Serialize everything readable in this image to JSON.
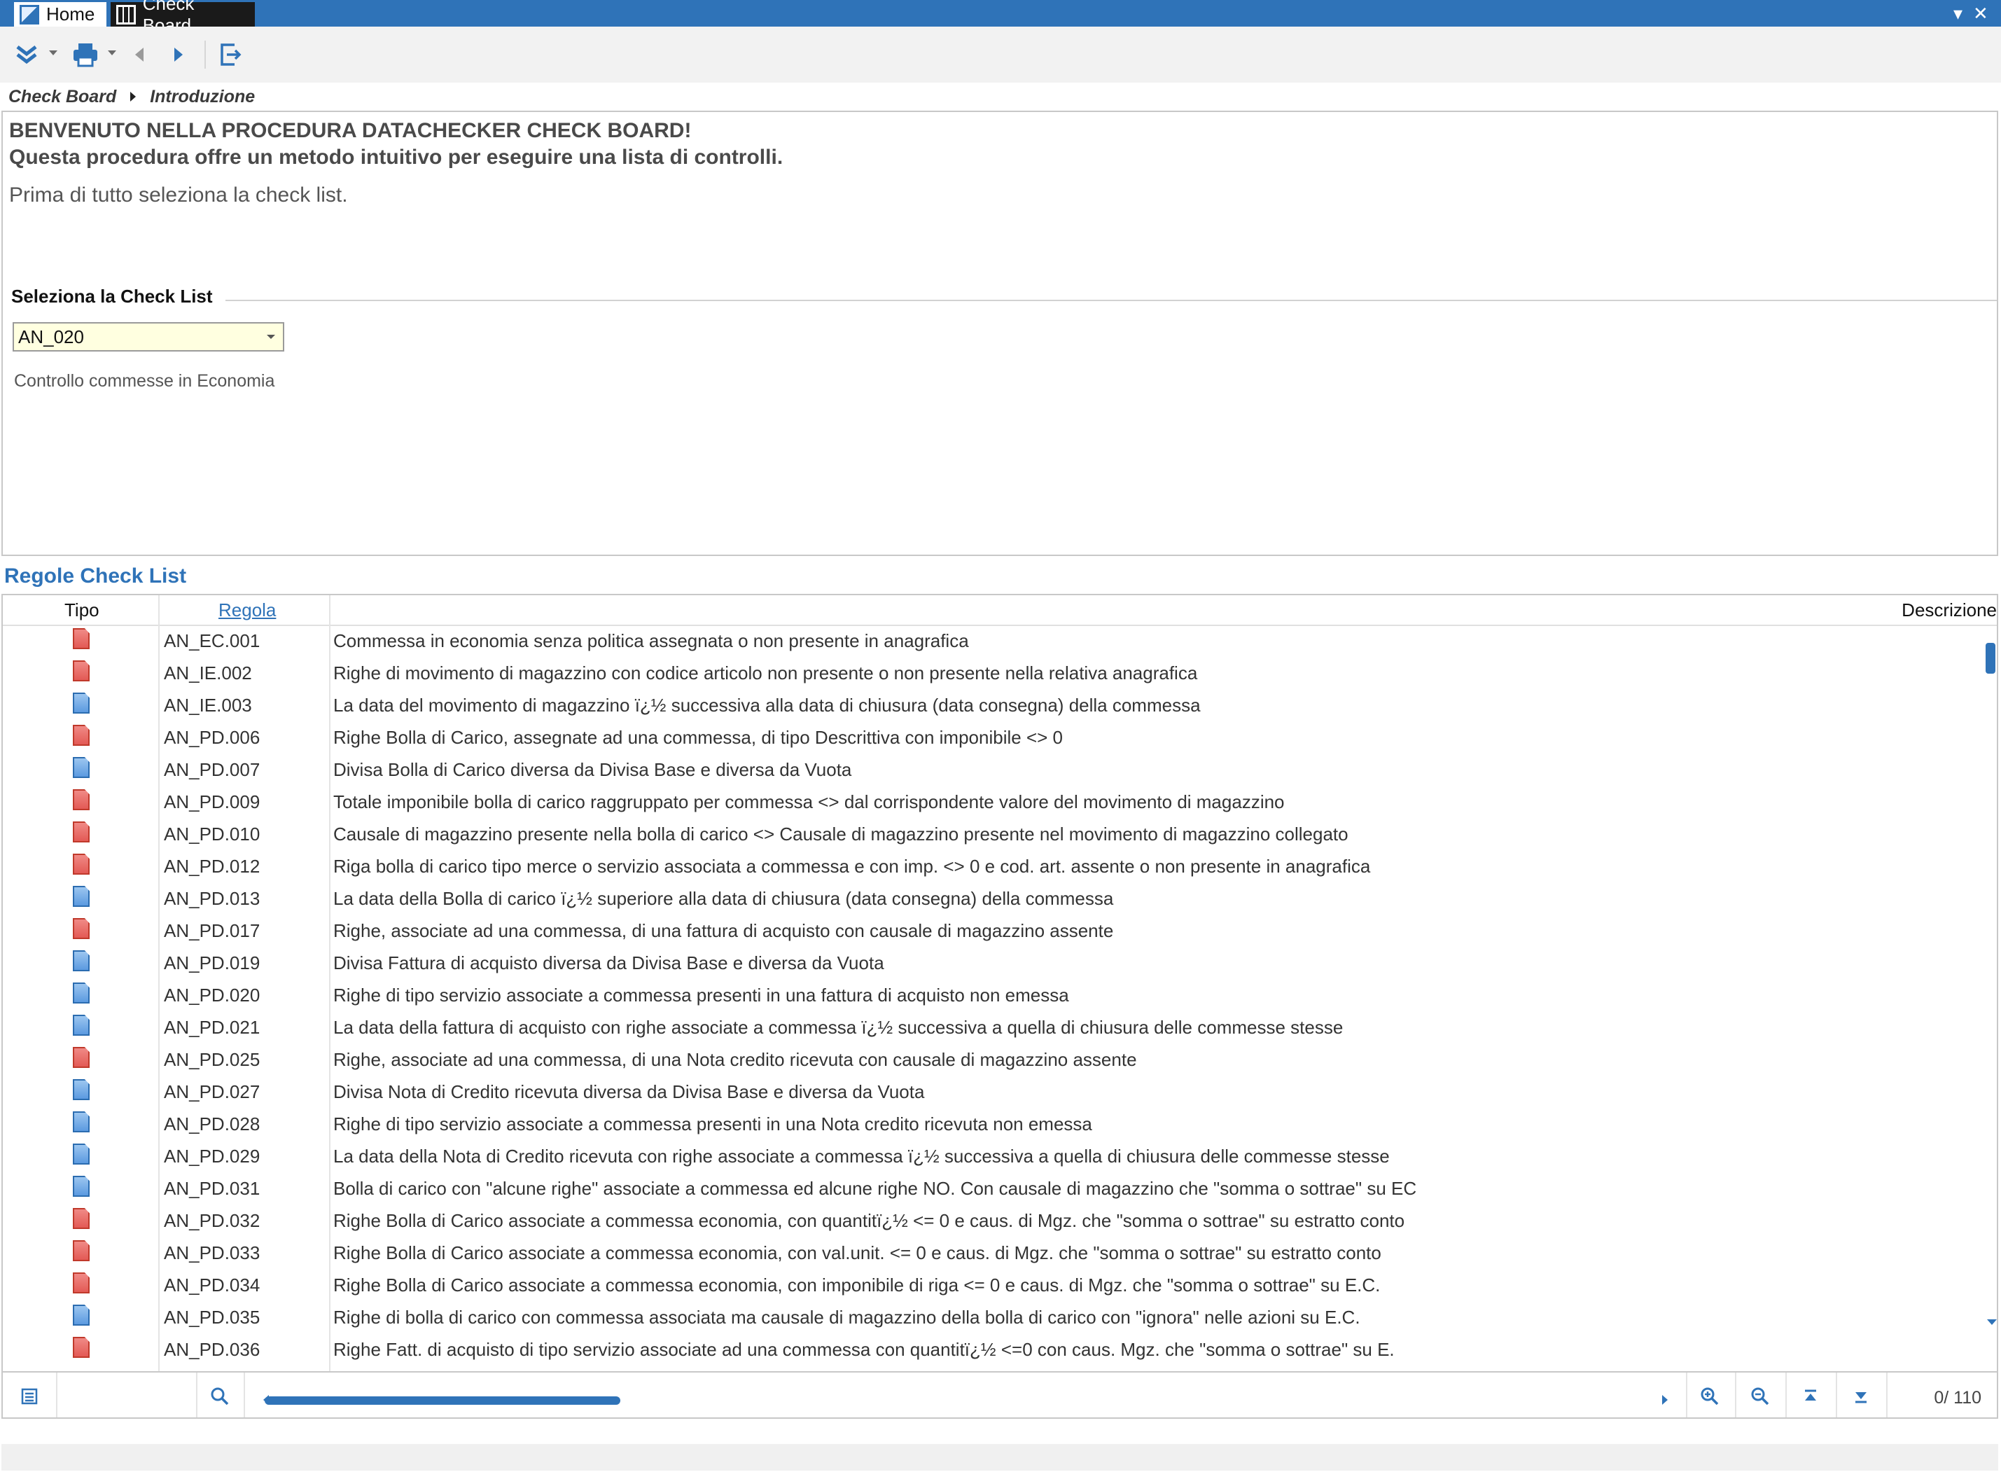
{
  "tabs": [
    {
      "label": "Home"
    },
    {
      "label": "Check Board"
    }
  ],
  "window_controls": {
    "dropdown_glyph": "▾",
    "close_glyph": "✕"
  },
  "toolbar": {
    "icons": [
      "expand-chevrons-icon",
      "print-icon",
      "back-arrow-icon",
      "forward-arrow-icon",
      "exit-icon"
    ]
  },
  "breadcrumb": {
    "root": "Check Board",
    "current": "Introduzione"
  },
  "intro": {
    "line1": "BENVENUTO NELLA PROCEDURA DATACHECKER CHECK BOARD!",
    "line2": "Questa procedura offre un metodo intuitivo per eseguire una lista di controlli.",
    "line3": "Prima di tutto seleziona la check list."
  },
  "checklist_group": {
    "legend": "Seleziona la Check List",
    "selected_value": "AN_020",
    "description": "Controllo commesse in Economia"
  },
  "rules": {
    "title": "Regole Check List",
    "columns": {
      "tipo": "Tipo",
      "regola": "Regola",
      "descrizione": "Descrizione"
    },
    "rows": [
      {
        "type": "red",
        "code": "AN_EC.001",
        "desc": "Commessa in economia senza politica assegnata o non presente in anagrafica"
      },
      {
        "type": "red",
        "code": "AN_IE.002",
        "desc": "Righe di movimento di magazzino con codice articolo non presente o non presente nella relativa anagrafica"
      },
      {
        "type": "blue",
        "code": "AN_IE.003",
        "desc": "La data del movimento di magazzino ï¿½ successiva alla data di chiusura (data consegna) della commessa"
      },
      {
        "type": "red",
        "code": "AN_PD.006",
        "desc": "Righe Bolla di Carico, assegnate ad una commessa, di tipo Descrittiva con imponibile <> 0"
      },
      {
        "type": "blue",
        "code": "AN_PD.007",
        "desc": "Divisa Bolla di Carico diversa da Divisa Base e diversa da Vuota"
      },
      {
        "type": "red",
        "code": "AN_PD.009",
        "desc": "Totale imponibile bolla di carico raggruppato per commessa <> dal corrispondente valore del movimento di magazzino"
      },
      {
        "type": "red",
        "code": "AN_PD.010",
        "desc": "Causale di magazzino presente nella bolla di carico <> Causale di magazzino presente nel movimento di magazzino collegato"
      },
      {
        "type": "red",
        "code": "AN_PD.012",
        "desc": "Riga bolla di carico tipo merce o servizio associata a commessa e con imp. <> 0 e cod. art. assente o non presente in anagrafica"
      },
      {
        "type": "blue",
        "code": "AN_PD.013",
        "desc": "La data della Bolla di carico ï¿½ superiore alla data di chiusura (data consegna) della commessa"
      },
      {
        "type": "red",
        "code": "AN_PD.017",
        "desc": "Righe, associate ad una commessa, di una fattura di acquisto con causale di magazzino assente"
      },
      {
        "type": "blue",
        "code": "AN_PD.019",
        "desc": "Divisa Fattura di acquisto diversa da Divisa Base e diversa da Vuota"
      },
      {
        "type": "blue",
        "code": "AN_PD.020",
        "desc": "Righe di tipo servizio associate a commessa presenti in una fattura di acquisto non emessa"
      },
      {
        "type": "blue",
        "code": "AN_PD.021",
        "desc": "La data della fattura di acquisto con righe associate a commessa ï¿½ successiva a quella di chiusura delle commesse stesse"
      },
      {
        "type": "red",
        "code": "AN_PD.025",
        "desc": "Righe, associate ad una commessa, di una Nota credito ricevuta con causale di magazzino assente"
      },
      {
        "type": "blue",
        "code": "AN_PD.027",
        "desc": "Divisa Nota di Credito ricevuta diversa da Divisa Base e diversa da Vuota"
      },
      {
        "type": "blue",
        "code": "AN_PD.028",
        "desc": "Righe di tipo servizio associate a commessa presenti in una Nota credito ricevuta non emessa"
      },
      {
        "type": "blue",
        "code": "AN_PD.029",
        "desc": "La data della Nota di Credito ricevuta con righe associate a commessa ï¿½ successiva a quella di chiusura delle commesse stesse"
      },
      {
        "type": "blue",
        "code": "AN_PD.031",
        "desc": "Bolla di carico con \"alcune righe\" associate a commessa ed alcune righe NO. Con causale di magazzino che \"somma o sottrae\" su EC"
      },
      {
        "type": "red",
        "code": "AN_PD.032",
        "desc": "Righe Bolla di Carico associate a commessa economia, con quantitï¿½ <= 0 e caus. di Mgz. che \"somma o sottrae\" su estratto conto"
      },
      {
        "type": "red",
        "code": "AN_PD.033",
        "desc": "Righe Bolla di Carico associate a commessa economia, con val.unit. <= 0 e caus. di Mgz. che \"somma o sottrae\" su estratto conto"
      },
      {
        "type": "red",
        "code": "AN_PD.034",
        "desc": "Righe Bolla di Carico associate a commessa economia, con imponibile di riga <= 0 e caus. di Mgz. che \"somma o sottrae\" su E.C."
      },
      {
        "type": "blue",
        "code": "AN_PD.035",
        "desc": "Righe di bolla di carico con commessa associata ma causale di magazzino della bolla di carico con \"ignora\" nelle azioni su E.C."
      },
      {
        "type": "red",
        "code": "AN_PD.036",
        "desc": "Righe Fatt. di acquisto di tipo servizio associate ad una commessa con quantitï¿½ <=0 con caus. Mgz. che \"somma o sottrae\" su E."
      }
    ]
  },
  "footer": {
    "pager_current": "0/",
    "pager_total": "110",
    "icons": [
      "list-icon",
      "search-icon",
      "zoom-in-icon",
      "zoom-out-icon",
      "first-record-icon",
      "last-record-icon"
    ]
  },
  "colors": {
    "accent": "#2f73b8",
    "doc_red": "#e35a55",
    "doc_blue": "#5b9ae0",
    "combo_bg": "#ffffe0"
  }
}
